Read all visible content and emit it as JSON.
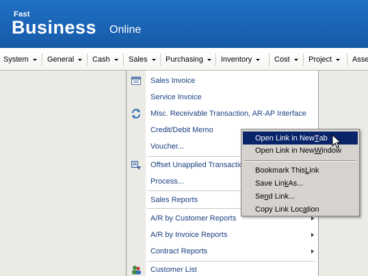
{
  "brand": {
    "top": "Fast",
    "main": "Business",
    "sub": "Online"
  },
  "menubar": {
    "items": [
      {
        "label": "System"
      },
      {
        "label": "General"
      },
      {
        "label": "Cash"
      },
      {
        "label": "Sales"
      },
      {
        "label": "Purchasing"
      },
      {
        "label": "Inventory"
      },
      {
        "label": "Cost"
      },
      {
        "label": "Project"
      },
      {
        "label": "Asse"
      }
    ]
  },
  "sales_menu": {
    "items": [
      {
        "label": "Sales Invoice"
      },
      {
        "label": "Service Invoice"
      },
      {
        "label": "Misc. Receivable Transaction, AR-AP Interface"
      },
      {
        "label": "Credit/Debit Memo"
      },
      {
        "label": "Voucher..."
      },
      {
        "label": "Offset Unapplied Transactio"
      },
      {
        "label": "Process..."
      },
      {
        "label": "Sales Reports"
      },
      {
        "label": "A/R by Customer Reports"
      },
      {
        "label": "A/R by Invoice Reports"
      },
      {
        "label": "Contract Reports"
      },
      {
        "label": "Customer List"
      }
    ]
  },
  "context_menu": {
    "open_new_tab": {
      "pre": "Open Link in New ",
      "key": "T",
      "post": "ab"
    },
    "open_new_window": {
      "pre": "Open Link in New ",
      "key": "W",
      "post": "indow"
    },
    "bookmark": {
      "pre": "Bookmark This ",
      "key": "L",
      "post": "ink"
    },
    "save_link": {
      "pre": "Save Lin",
      "key": "k",
      "post": " As..."
    },
    "send_link": {
      "pre": "Se",
      "key": "n",
      "post": "d Link..."
    },
    "copy_link": {
      "pre": "Copy Link Loc",
      "key": "a",
      "post": "tion"
    }
  },
  "colors": {
    "banner": "#1a63b4",
    "menu_link": "#1a3f80",
    "highlight": "#0a246a",
    "context_bg": "#d6d3ce",
    "page_bg": "#ebeae5"
  }
}
